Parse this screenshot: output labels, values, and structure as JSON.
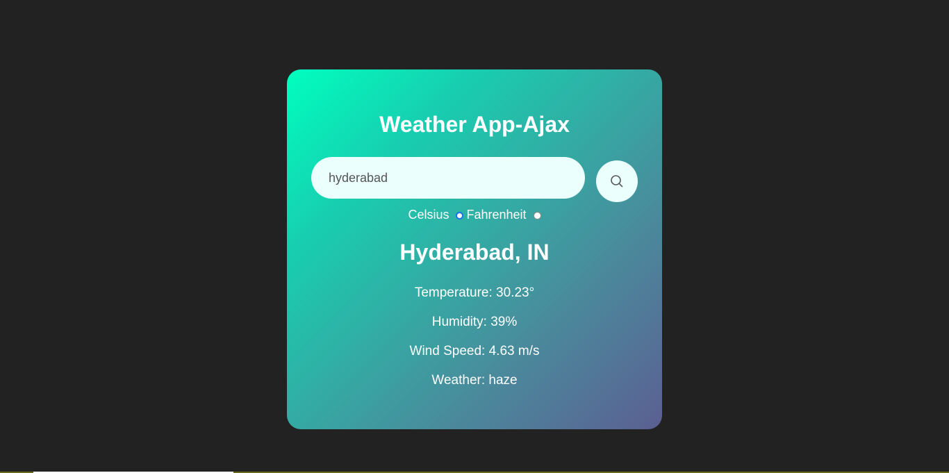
{
  "app": {
    "title": "Weather App-Ajax"
  },
  "search": {
    "value": "hyderabad",
    "button_icon": "search-icon"
  },
  "units": {
    "celsius_label": "Celsius",
    "fahrenheit_label": "Fahrenheit",
    "selected": "Celsius"
  },
  "result": {
    "city": "Hyderabad, IN",
    "temperature": "Temperature: 30.23°",
    "humidity": "Humidity: 39%",
    "wind_speed": "Wind Speed: 4.63 m/s",
    "weather": "Weather: haze"
  },
  "colors": {
    "background": "#222222",
    "card_gradient_start": "#00ffbf",
    "card_gradient_end": "#5b5f92",
    "input_background": "#ebfffc",
    "radio_selected": "#1a73e8"
  }
}
